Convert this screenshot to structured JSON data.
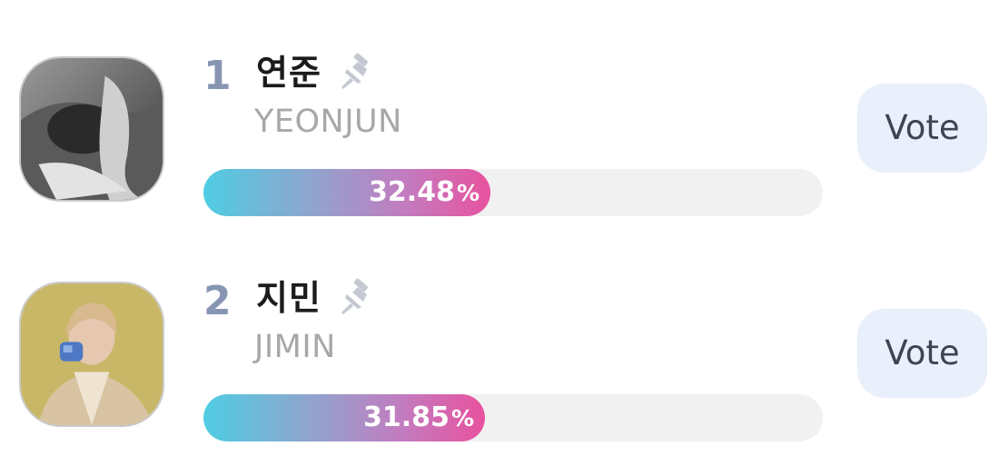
{
  "candidates": [
    {
      "rank": "1",
      "name_ko": "연준",
      "name_en": "YEONJUN",
      "percent_value": "32.48",
      "percent_sign": "%",
      "vote_share": 32.48,
      "vote_label": "Vote",
      "pin_icon": "pin-icon",
      "avatar_icon": "avatar-photo"
    },
    {
      "rank": "2",
      "name_ko": "지민",
      "name_en": "JIMIN",
      "percent_value": "31.85",
      "percent_sign": "%",
      "vote_share": 31.85,
      "vote_label": "Vote",
      "pin_icon": "pin-icon",
      "avatar_icon": "avatar-photo"
    }
  ],
  "colors": {
    "rank": "#8795b3",
    "bar_start": "#4fcde3",
    "bar_end": "#e8529e",
    "vote_bg": "#e9f0fb"
  }
}
